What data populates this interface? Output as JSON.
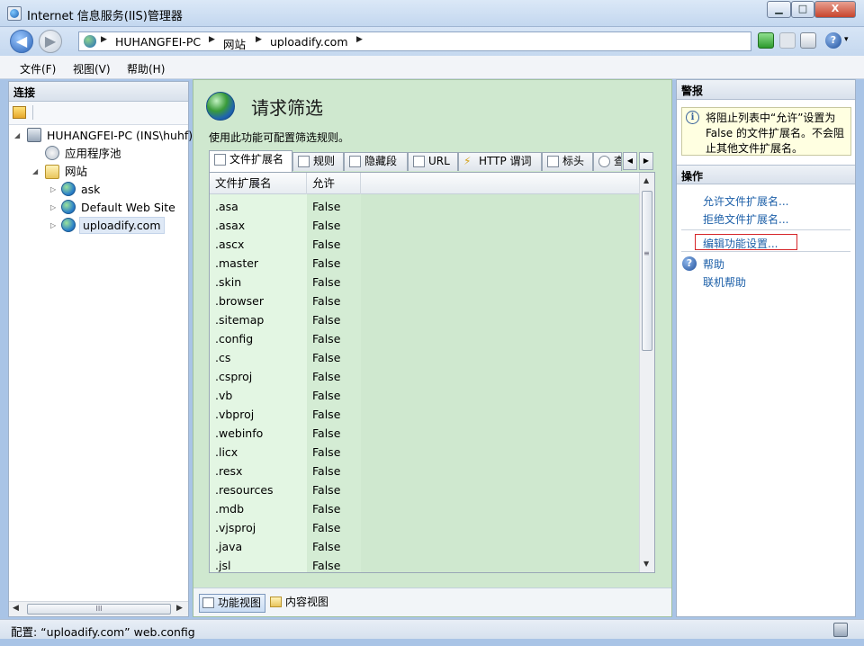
{
  "window": {
    "title": "Internet 信息服务(IIS)管理器",
    "min_glyph": "▁",
    "max_glyph": "□",
    "close_glyph": "X"
  },
  "nav": {
    "back_glyph": "◀",
    "forward_glyph": "▶",
    "breadcrumbs": [
      "HUHANGFEI-PC",
      "网站",
      "uploadify.com"
    ],
    "sep_glyph": "▶",
    "help_glyph": "?",
    "help_arrow": "▾"
  },
  "menu": {
    "items": [
      "文件(F)",
      "视图(V)",
      "帮助(H)"
    ]
  },
  "connections": {
    "title": "连接",
    "tree": [
      {
        "label": "HUHANGFEI-PC (INS\\huhf)",
        "twisty": "◢",
        "icon": "server-icon"
      },
      {
        "label": "应用程序池",
        "twisty": "",
        "icon": "app-pool-icon"
      },
      {
        "label": "网站",
        "twisty": "◢",
        "icon": "folder-icon"
      },
      {
        "label": "ask",
        "twisty": "▷",
        "icon": "globe-icon"
      },
      {
        "label": "Default Web Site",
        "twisty": "▷",
        "icon": "globe-icon"
      },
      {
        "label": "uploadify.com",
        "twisty": "▷",
        "icon": "globe-icon"
      }
    ],
    "scroll_left": "◀",
    "scroll_right": "▶",
    "scroll_grip": "III"
  },
  "feature": {
    "title": "请求筛选",
    "description": "使用此功能可配置筛选规则。",
    "tabs": [
      "文件扩展名",
      "规则",
      "隐藏段",
      "URL",
      "HTTP 谓词",
      "标头",
      "查"
    ],
    "tab_scroll_left": "◀",
    "tab_scroll_right": "▶",
    "columns": [
      "文件扩展名",
      "允许"
    ],
    "sort_glyph": "▲",
    "rows": [
      [
        ".asa",
        "False"
      ],
      [
        ".asax",
        "False"
      ],
      [
        ".ascx",
        "False"
      ],
      [
        ".master",
        "False"
      ],
      [
        ".skin",
        "False"
      ],
      [
        ".browser",
        "False"
      ],
      [
        ".sitemap",
        "False"
      ],
      [
        ".config",
        "False"
      ],
      [
        ".cs",
        "False"
      ],
      [
        ".csproj",
        "False"
      ],
      [
        ".vb",
        "False"
      ],
      [
        ".vbproj",
        "False"
      ],
      [
        ".webinfo",
        "False"
      ],
      [
        ".licx",
        "False"
      ],
      [
        ".resx",
        "False"
      ],
      [
        ".resources",
        "False"
      ],
      [
        ".mdb",
        "False"
      ],
      [
        ".vjsproj",
        "False"
      ],
      [
        ".java",
        "False"
      ],
      [
        ".jsl",
        "False"
      ]
    ],
    "scroll_up": "▲",
    "scroll_down": "▼",
    "scroll_grip": "≡",
    "view_buttons": [
      "功能视图",
      "内容视图"
    ]
  },
  "actions": {
    "alert_title": "警报",
    "alert_icon": "i",
    "alert_text": "将阻止列表中“允许”设置为 False 的文件扩展名。不会阻止其他文件扩展名。",
    "title": "操作",
    "links": [
      "允许文件扩展名...",
      "拒绝文件扩展名...",
      "编辑功能设置...",
      "帮助",
      "联机帮助"
    ],
    "help_glyph": "?"
  },
  "status": {
    "text": "配置: “uploadify.com” web.config"
  },
  "colors": {
    "feature_background": "#cfe8cf",
    "link": "#1c5fa8",
    "highlight_box": "#d6262a"
  }
}
